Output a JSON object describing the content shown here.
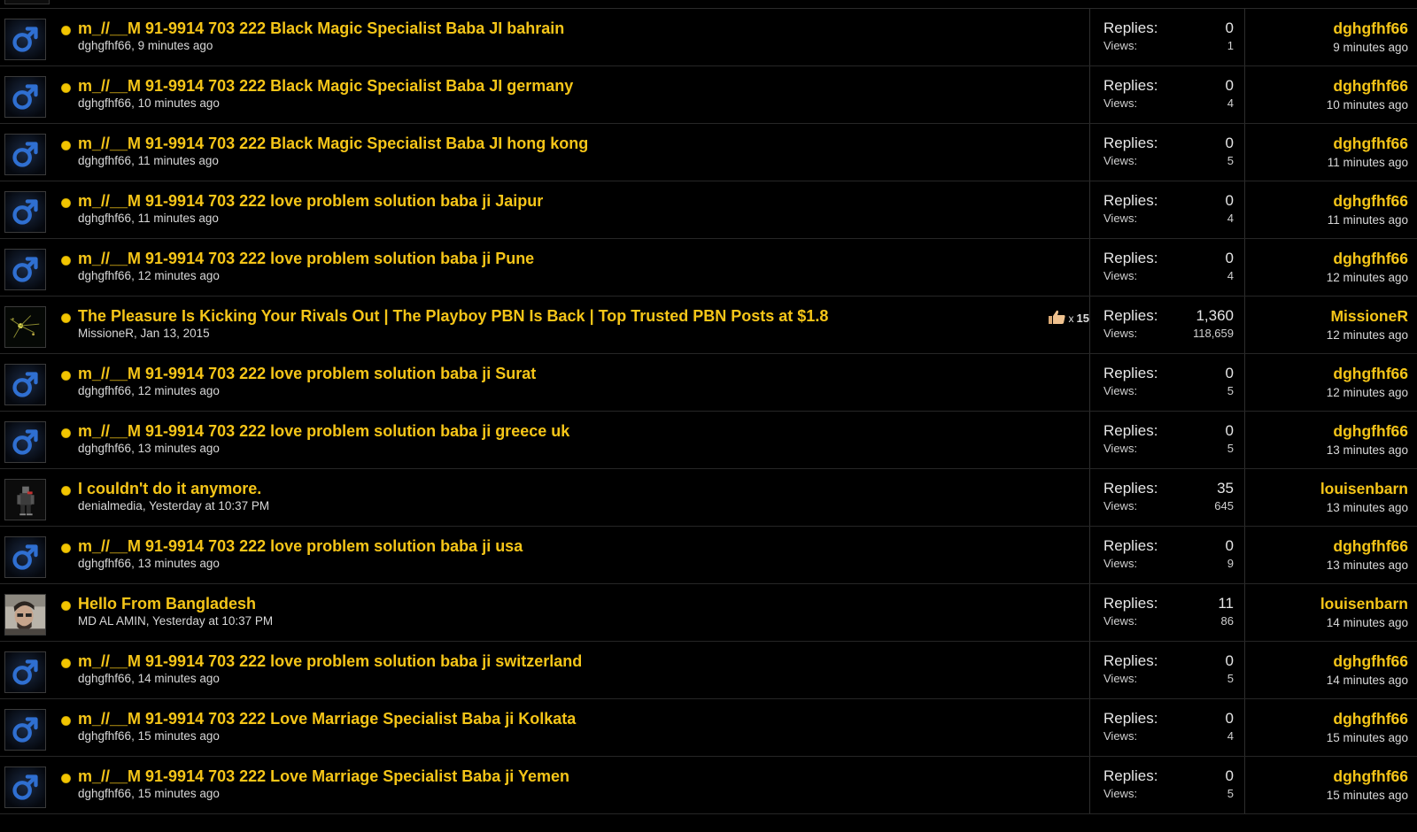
{
  "threads": [
    {
      "avatar": "male-symbol-icon",
      "title": "m_//__M 91-9914 703 222 Black Magic Specialist Baba JI bahrain",
      "starter": "dghgfhf66",
      "start_time": "9 minutes ago",
      "replies_label": "Replies:",
      "replies": "0",
      "views_label": "Views:",
      "views": "1",
      "last_user": "dghgfhf66",
      "last_time": "9 minutes ago"
    },
    {
      "avatar": "male-symbol-icon",
      "title": "m_//__M 91-9914 703 222 Black Magic Specialist Baba JI germany",
      "starter": "dghgfhf66",
      "start_time": "10 minutes ago",
      "replies_label": "Replies:",
      "replies": "0",
      "views_label": "Views:",
      "views": "4",
      "last_user": "dghgfhf66",
      "last_time": "10 minutes ago"
    },
    {
      "avatar": "male-symbol-icon",
      "title": "m_//__M 91-9914 703 222 Black Magic Specialist Baba JI hong kong",
      "starter": "dghgfhf66",
      "start_time": "11 minutes ago",
      "replies_label": "Replies:",
      "replies": "0",
      "views_label": "Views:",
      "views": "5",
      "last_user": "dghgfhf66",
      "last_time": "11 minutes ago"
    },
    {
      "avatar": "male-symbol-icon",
      "title": "m_//__M 91-9914 703 222 love problem solution baba ji Jaipur",
      "starter": "dghgfhf66",
      "start_time": "11 minutes ago",
      "replies_label": "Replies:",
      "replies": "0",
      "views_label": "Views:",
      "views": "4",
      "last_user": "dghgfhf66",
      "last_time": "11 minutes ago"
    },
    {
      "avatar": "male-symbol-icon",
      "title": "m_//__M 91-9914 703 222 love problem solution baba ji Pune",
      "starter": "dghgfhf66",
      "start_time": "12 minutes ago",
      "replies_label": "Replies:",
      "replies": "0",
      "views_label": "Views:",
      "views": "4",
      "last_user": "dghgfhf66",
      "last_time": "12 minutes ago"
    },
    {
      "avatar": "sparkle-avatar-icon",
      "title": "The Pleasure Is Kicking Your Rivals Out | The Playboy PBN Is Back | Top Trusted PBN Posts at $1.8",
      "starter": "MissioneR",
      "start_time": "Jan 13, 2015",
      "likes_x": "x",
      "likes": "15",
      "replies_label": "Replies:",
      "replies": "1,360",
      "views_label": "Views:",
      "views": "118,659",
      "last_user": "MissioneR",
      "last_time": "12 minutes ago"
    },
    {
      "avatar": "male-symbol-icon",
      "title": "m_//__M 91-9914 703 222 love problem solution baba ji Surat",
      "starter": "dghgfhf66",
      "start_time": "12 minutes ago",
      "replies_label": "Replies:",
      "replies": "0",
      "views_label": "Views:",
      "views": "5",
      "last_user": "dghgfhf66",
      "last_time": "12 minutes ago"
    },
    {
      "avatar": "male-symbol-icon",
      "title": "m_//__M 91-9914 703 222 love problem solution baba ji greece uk",
      "starter": "dghgfhf66",
      "start_time": "13 minutes ago",
      "replies_label": "Replies:",
      "replies": "0",
      "views_label": "Views:",
      "views": "5",
      "last_user": "dghgfhf66",
      "last_time": "13 minutes ago"
    },
    {
      "avatar": "character-avatar-icon",
      "title": "I couldn't do it anymore.",
      "starter": "denialmedia",
      "start_time": "Yesterday at 10:37 PM",
      "replies_label": "Replies:",
      "replies": "35",
      "views_label": "Views:",
      "views": "645",
      "last_user": "louisenbarn",
      "last_time": "13 minutes ago"
    },
    {
      "avatar": "male-symbol-icon",
      "title": "m_//__M 91-9914 703 222 love problem solution baba ji usa",
      "starter": "dghgfhf66",
      "start_time": "13 minutes ago",
      "replies_label": "Replies:",
      "replies": "0",
      "views_label": "Views:",
      "views": "9",
      "last_user": "dghgfhf66",
      "last_time": "13 minutes ago"
    },
    {
      "avatar": "photo-avatar-icon",
      "title": "Hello From Bangladesh",
      "starter": "MD AL AMIN",
      "start_time": "Yesterday at 10:37 PM",
      "replies_label": "Replies:",
      "replies": "11",
      "views_label": "Views:",
      "views": "86",
      "last_user": "louisenbarn",
      "last_time": "14 minutes ago"
    },
    {
      "avatar": "male-symbol-icon",
      "title": "m_//__M 91-9914 703 222 love problem solution baba ji switzerland",
      "starter": "dghgfhf66",
      "start_time": "14 minutes ago",
      "replies_label": "Replies:",
      "replies": "0",
      "views_label": "Views:",
      "views": "5",
      "last_user": "dghgfhf66",
      "last_time": "14 minutes ago"
    },
    {
      "avatar": "male-symbol-icon",
      "title": "m_//__M 91-9914 703 222 Love Marriage Specialist Baba ji Kolkata",
      "starter": "dghgfhf66",
      "start_time": "15 minutes ago",
      "replies_label": "Replies:",
      "replies": "0",
      "views_label": "Views:",
      "views": "4",
      "last_user": "dghgfhf66",
      "last_time": "15 minutes ago"
    },
    {
      "avatar": "male-symbol-icon",
      "title": "m_//__M 91-9914 703 222 Love Marriage Specialist Baba ji Yemen",
      "starter": "dghgfhf66",
      "start_time": "15 minutes ago",
      "replies_label": "Replies:",
      "replies": "0",
      "views_label": "Views:",
      "views": "5",
      "last_user": "dghgfhf66",
      "last_time": "15 minutes ago"
    }
  ],
  "colors": {
    "title": "#f5c518",
    "unread_dot": "#f2c500",
    "male_icon": "#2f6fd1",
    "background": "#000000"
  }
}
